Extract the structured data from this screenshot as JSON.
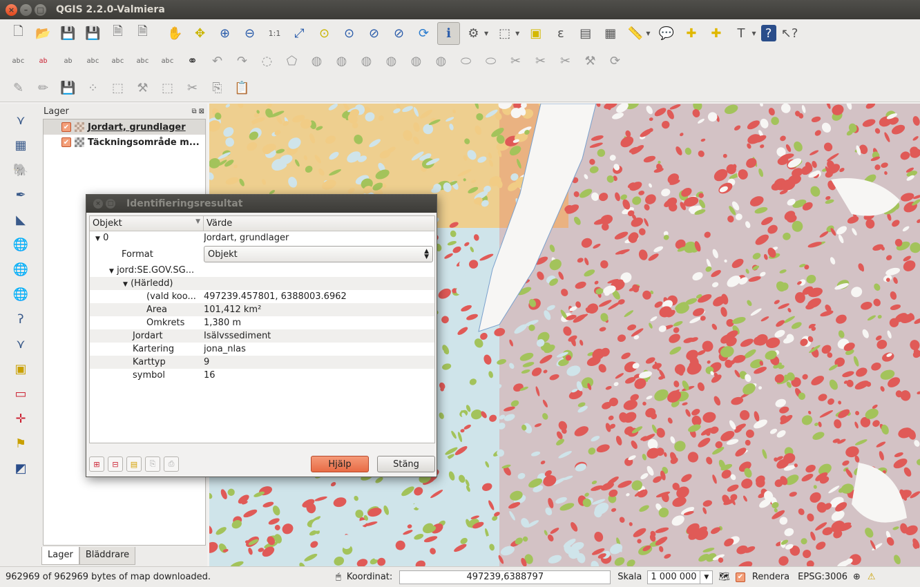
{
  "window": {
    "title": "QGIS 2.2.0-Valmiera"
  },
  "layers_panel": {
    "title": "Lager",
    "items": [
      {
        "label": "Jordart, grundlager",
        "checked": true
      },
      {
        "label": "Täckningsområde m..."
      }
    ],
    "tabs": [
      "Lager",
      "Bläddrare"
    ]
  },
  "identify_dialog": {
    "title": "Identifieringsresultat",
    "columns": [
      "Objekt",
      "Värde"
    ],
    "root": {
      "id": "0",
      "value": "Jordart, grundlager"
    },
    "format": {
      "label": "Format",
      "value": "Objekt"
    },
    "feature": "jord:SE.GOV.SG...",
    "derived_label": "(Härledd)",
    "derived": [
      {
        "key": "(vald koo...",
        "value": "497239.457801, 6388003.6962"
      },
      {
        "key": "Area",
        "value": "101,412 km²"
      },
      {
        "key": "Omkrets",
        "value": "1,380 m"
      }
    ],
    "attributes": [
      {
        "key": "Jordart",
        "value": "Isälvssediment"
      },
      {
        "key": "Kartering",
        "value": "jona_nlas"
      },
      {
        "key": "Karttyp",
        "value": "9"
      },
      {
        "key": "symbol",
        "value": "16"
      }
    ],
    "help_button": "Hjälp",
    "close_button": "Stäng"
  },
  "status": {
    "message": "962969 of 962969 bytes of map downloaded.",
    "coord_label": "Koordinat:",
    "coord_value": "497239,6388797",
    "scale_label": "Skala",
    "scale_value": "1 000 000",
    "render_label": "Rendera",
    "crs": "EPSG:3006"
  },
  "toolbar1_icons": [
    "new-project-icon",
    "open-project-icon",
    "save-project-icon",
    "save-as-icon",
    "new-print-composer-icon",
    "composer-manager-icon",
    "pan-icon",
    "pan-to-selection-icon",
    "zoom-in-icon",
    "zoom-out-icon",
    "zoom-actual-icon",
    "zoom-full-icon",
    "zoom-to-selection-icon",
    "zoom-to-layer-icon",
    "zoom-last-icon",
    "zoom-next-icon",
    "refresh-icon",
    "identify-icon",
    "action-icon",
    "select-icon",
    "deselect-icon",
    "expression-icon",
    "attribute-table-icon",
    "field-calculator-icon",
    "measure-icon",
    "annotation-icon",
    "new-bookmark-icon",
    "show-bookmarks-icon",
    "text-annotation-icon",
    "help-icon",
    "whats-this-icon"
  ],
  "colors": {
    "map_red": "#e05a57",
    "map_green": "#a3c35b",
    "map_blue": "#cfe4ea",
    "map_tan": "#f1cc85",
    "map_white": "#f7f6f4"
  }
}
